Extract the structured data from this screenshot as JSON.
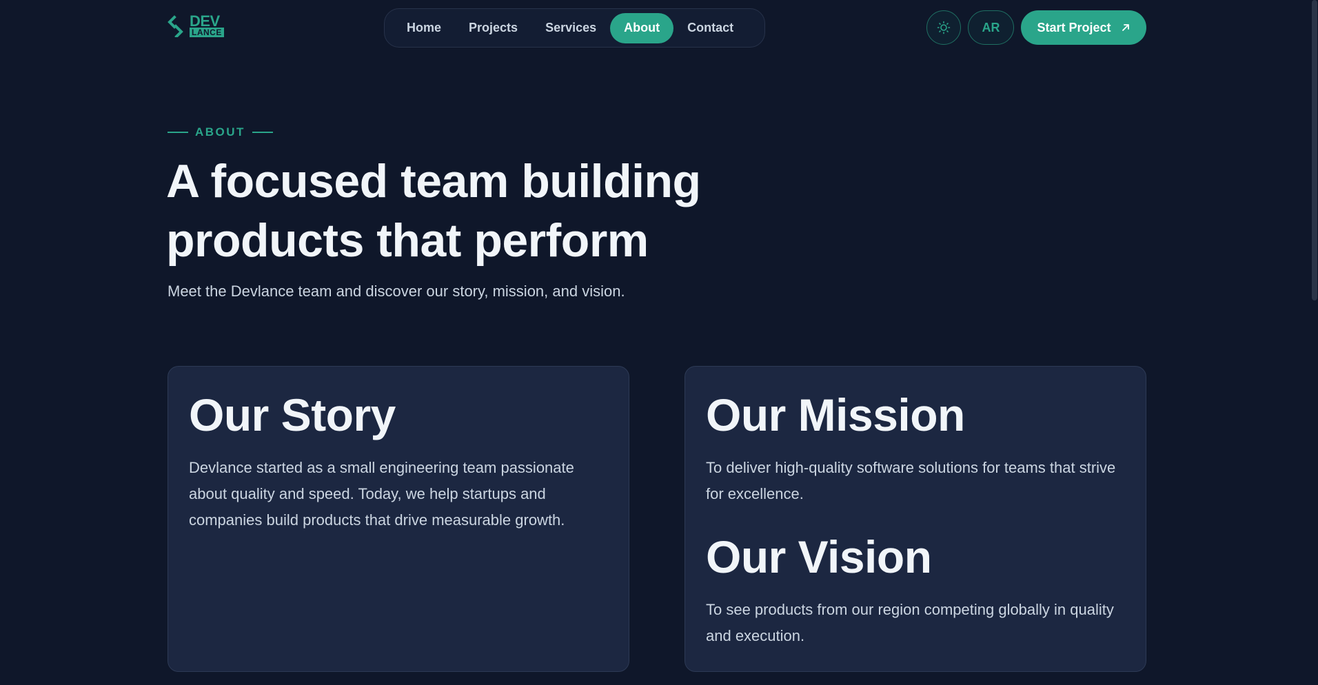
{
  "brand": {
    "logo_top": "DEV",
    "logo_bottom": "LANCE",
    "accent_color": "#2aa58a"
  },
  "nav": {
    "items": [
      {
        "label": "Home",
        "active": false
      },
      {
        "label": "Projects",
        "active": false
      },
      {
        "label": "Services",
        "active": false
      },
      {
        "label": "About",
        "active": true
      },
      {
        "label": "Contact",
        "active": false
      }
    ]
  },
  "header_actions": {
    "theme_icon": "sun-icon",
    "lang_label": "AR",
    "cta_label": "Start Project",
    "cta_icon": "arrow-up-right-icon"
  },
  "hero": {
    "eyebrow": "ABOUT",
    "title_line1": "A focused team building",
    "title_line2": "products that perform",
    "subtitle": "Meet the Devlance team and discover our story, mission, and vision."
  },
  "cards": {
    "story": {
      "title": "Our Story",
      "text": "Devlance started as a small engineering team passionate about quality and speed. Today, we help startups and companies build products that drive measurable growth."
    },
    "mission": {
      "title": "Our Mission",
      "text": "To deliver high-quality software solutions for teams that strive for excellence."
    },
    "vision": {
      "title": "Our Vision",
      "text": "To see products from our region competing globally in quality and execution."
    }
  }
}
